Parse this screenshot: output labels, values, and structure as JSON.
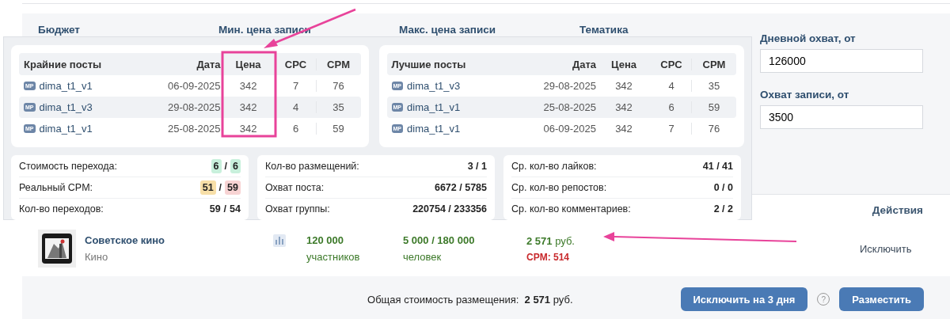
{
  "filters": {
    "labels": [
      "Бюджет",
      "Мин. цена записи",
      "Макс. цена записи",
      "Тематика"
    ],
    "fields": [
      {
        "label": "Дневной охват, от",
        "value": "126000"
      },
      {
        "label": "Охват записи, от",
        "value": "3500"
      }
    ]
  },
  "popup": {
    "tables": [
      {
        "columns": [
          "Крайние посты",
          "Дата",
          "Цена",
          "CPC",
          "CPM"
        ],
        "rows": [
          {
            "badge": "MP",
            "name": "dima_t1_v1",
            "date": "06-09-2025",
            "price": "342",
            "cpc": "7",
            "cpm": "76"
          },
          {
            "badge": "MP",
            "name": "dima_t1_v3",
            "date": "29-08-2025",
            "price": "342",
            "cpc": "4",
            "cpm": "35"
          },
          {
            "badge": "MP",
            "name": "dima_t1_v1",
            "date": "25-08-2025",
            "price": "342",
            "cpc": "6",
            "cpm": "59"
          }
        ]
      },
      {
        "columns": [
          "Лучшие посты",
          "Дата",
          "Цена",
          "CPC",
          "CPM"
        ],
        "rows": [
          {
            "badge": "MP",
            "name": "dima_t1_v3",
            "date": "29-08-2025",
            "price": "342",
            "cpc": "4",
            "cpm": "35"
          },
          {
            "badge": "MP",
            "name": "dima_t1_v1",
            "date": "25-08-2025",
            "price": "342",
            "cpc": "6",
            "cpm": "59"
          },
          {
            "badge": "MP",
            "name": "dima_t1_v1",
            "date": "06-09-2025",
            "price": "342",
            "cpc": "7",
            "cpm": "76"
          }
        ]
      }
    ],
    "stat_cards": [
      [
        {
          "label": "Стоимость перехода:",
          "separator": "/",
          "values": [
            {
              "text": "6",
              "color": "#c8f0dc"
            },
            {
              "text": "6",
              "color": "#c8f0dc"
            }
          ]
        },
        {
          "label": "Реальный CPM:",
          "separator": "/",
          "values": [
            {
              "text": "51",
              "color": "#f7dfa8"
            },
            {
              "text": "59",
              "color": "#f7d3d3"
            }
          ]
        },
        {
          "label": "Кол-во переходов:",
          "separator": "/",
          "values": [
            {
              "text": "59"
            },
            {
              "text": "54"
            }
          ]
        }
      ],
      [
        {
          "label": "Кол-во размещений:",
          "values": [
            {
              "text": "3 / 1"
            }
          ]
        },
        {
          "label": "Охват поста:",
          "values": [
            {
              "text": "6672 / 5785"
            }
          ]
        },
        {
          "label": "Охват группы:",
          "values": [
            {
              "text": "220754 / 233356"
            }
          ]
        }
      ],
      [
        {
          "label": "Ср. кол-во лайков:",
          "values": [
            {
              "text": "41 / 41"
            }
          ]
        },
        {
          "label": "Ср. кол-во репостов:",
          "values": [
            {
              "text": "0 / 0"
            }
          ]
        },
        {
          "label": "Ср. кол-во комментариев:",
          "values": [
            {
              "text": "2 / 2"
            }
          ]
        }
      ]
    ]
  },
  "table": {
    "columns": [
      "Действия"
    ],
    "rows": [
      {
        "name": "Советское кино",
        "topic": "Кино",
        "members": "120 000",
        "members_unit": "участников",
        "reach": "5 000 / 180 000",
        "reach_unit": "человек",
        "price": "2 571",
        "price_unit": "руб.",
        "cpm": "CPM: 514",
        "action": "Исключить"
      }
    ]
  },
  "footer": {
    "total": "Общая стоимость размещения:  **2 571** руб.",
    "buttons": [
      "Исключить на 3 дня",
      "Разместить"
    ],
    "help": "?"
  },
  "annotations": [
    {
      "kind": "arrow_down"
    },
    {
      "kind": "box"
    },
    {
      "kind": "arrow_left"
    }
  ]
}
